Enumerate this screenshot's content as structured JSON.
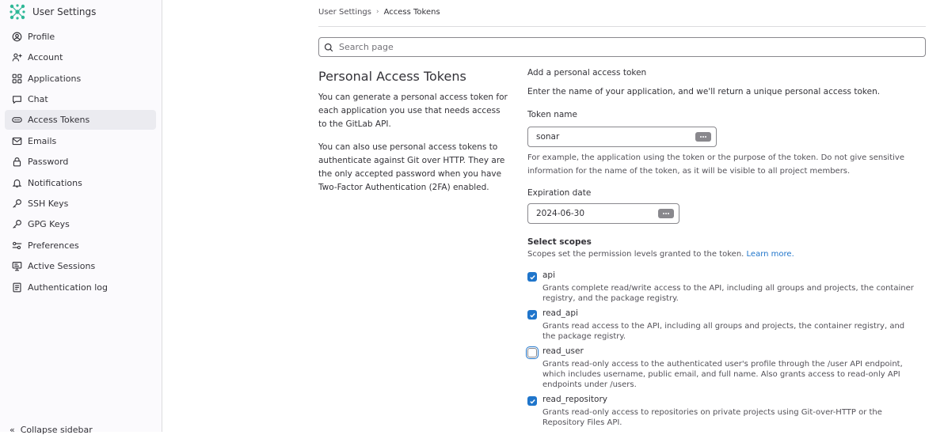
{
  "sidebar": {
    "title": "User Settings",
    "items": [
      {
        "label": "Profile",
        "icon": "profile-icon"
      },
      {
        "label": "Account",
        "icon": "account-icon"
      },
      {
        "label": "Applications",
        "icon": "applications-icon"
      },
      {
        "label": "Chat",
        "icon": "chat-icon"
      },
      {
        "label": "Access Tokens",
        "icon": "token-icon",
        "active": true
      },
      {
        "label": "Emails",
        "icon": "mail-icon"
      },
      {
        "label": "Password",
        "icon": "lock-icon"
      },
      {
        "label": "Notifications",
        "icon": "bell-icon"
      },
      {
        "label": "SSH Keys",
        "icon": "key-icon"
      },
      {
        "label": "GPG Keys",
        "icon": "key-icon"
      },
      {
        "label": "Preferences",
        "icon": "preferences-icon"
      },
      {
        "label": "Active Sessions",
        "icon": "monitor-icon"
      },
      {
        "label": "Authentication log",
        "icon": "log-icon"
      }
    ],
    "collapse_label": "Collapse sidebar"
  },
  "breadcrumb": {
    "parent": "User Settings",
    "current": "Access Tokens"
  },
  "search": {
    "placeholder": "Search page",
    "value": ""
  },
  "intro": {
    "title": "Personal Access Tokens",
    "p1": "You can generate a personal access token for each application you use that needs access to the GitLab API.",
    "p2": "You can also use personal access tokens to authenticate against Git over HTTP. They are the only accepted password when you have Two-Factor Authentication (2FA) enabled."
  },
  "form": {
    "heading": "Add a personal access token",
    "description": "Enter the name of your application, and we'll return a unique personal access token.",
    "token_name_label": "Token name",
    "token_name_value": "sonar",
    "token_name_help": "For example, the application using the token or the purpose of the token. Do not give sensitive information for the name of the token, as it will be visible to all project members.",
    "expiration_label": "Expiration date",
    "expiration_value": "2024-06-30",
    "scopes_label": "Select scopes",
    "scopes_help": "Scopes set the permission levels granted to the token.",
    "learn_more": "Learn more.",
    "scopes": [
      {
        "name": "api",
        "checked": true,
        "desc": "Grants complete read/write access to the API, including all groups and projects, the container registry, and the package registry."
      },
      {
        "name": "read_api",
        "checked": true,
        "desc": "Grants read access to the API, including all groups and projects, the container registry, and the package registry."
      },
      {
        "name": "read_user",
        "checked": false,
        "desc": "Grants read-only access to the authenticated user's profile through the /user API endpoint, which includes username, public email, and full name. Also grants access to read-only API endpoints under /users."
      },
      {
        "name": "read_repository",
        "checked": true,
        "desc": "Grants read-only access to repositories on private projects using Git-over-HTTP or the Repository Files API."
      }
    ]
  },
  "colors": {
    "accent": "#1f75cb",
    "active_nav": "#ebebf0",
    "sidebar_bg": "#fbfafd"
  }
}
